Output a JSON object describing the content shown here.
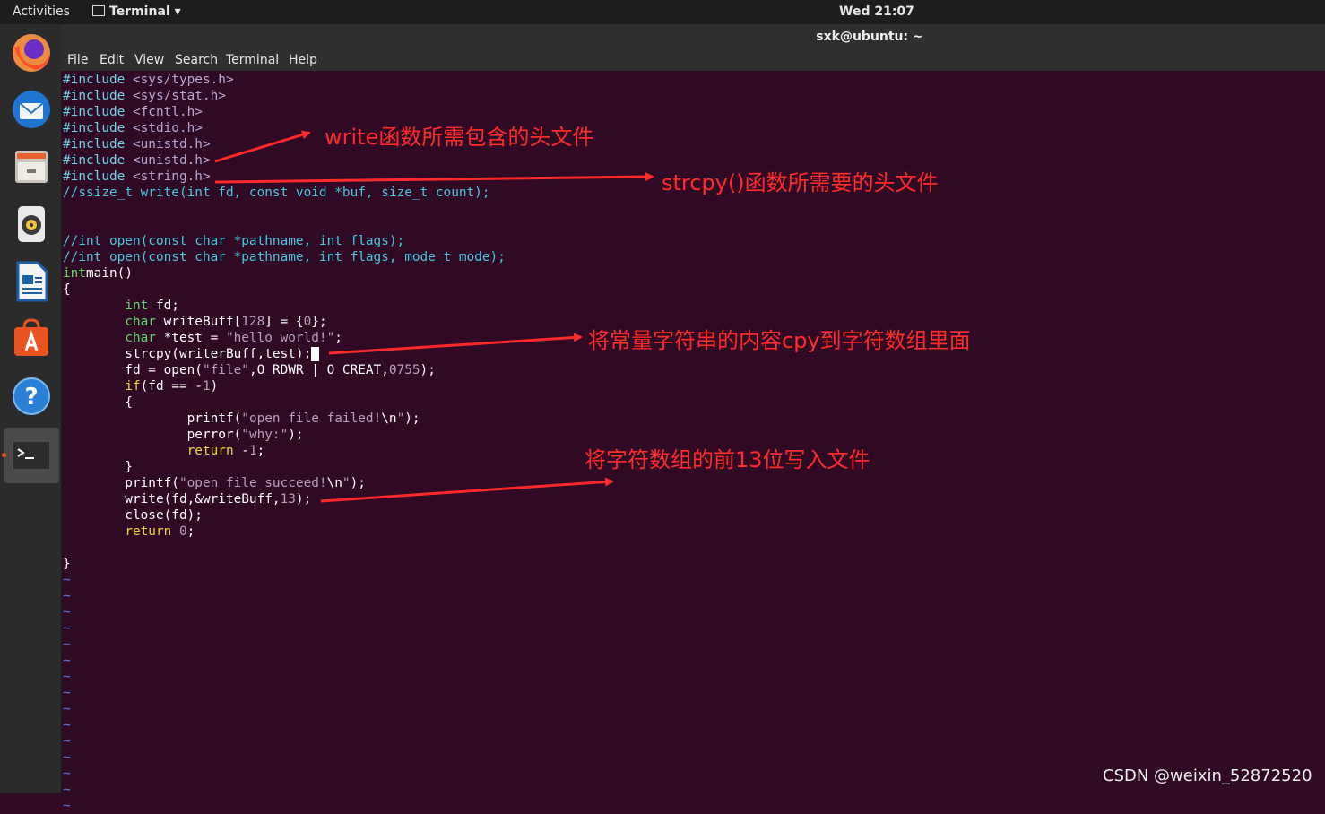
{
  "topbar": {
    "activities": "Activities",
    "app_name": "Terminal",
    "app_menu_arrow": "▾",
    "clock": "Wed 21:07"
  },
  "window": {
    "title": "sxk@ubuntu: ~"
  },
  "menu": [
    "File",
    "Edit",
    "View",
    "Search",
    "Terminal",
    "Help"
  ],
  "dock": [
    {
      "name": "firefox-icon"
    },
    {
      "name": "thunderbird-icon"
    },
    {
      "name": "files-icon"
    },
    {
      "name": "rhythmbox-icon"
    },
    {
      "name": "libreoffice-writer-icon"
    },
    {
      "name": "software-center-icon"
    },
    {
      "name": "help-icon"
    },
    {
      "name": "terminal-icon",
      "active": true
    }
  ],
  "code": [
    [
      [
        "pp",
        "#include "
      ],
      [
        "inc",
        "<sys/types.h>"
      ]
    ],
    [
      [
        "pp",
        "#include "
      ],
      [
        "inc",
        "<sys/stat.h>"
      ]
    ],
    [
      [
        "pp",
        "#include "
      ],
      [
        "inc",
        "<fcntl.h>"
      ]
    ],
    [
      [
        "pp",
        "#include "
      ],
      [
        "inc",
        "<stdio.h>"
      ]
    ],
    [
      [
        "pp",
        "#include "
      ],
      [
        "inc",
        "<unistd.h>"
      ]
    ],
    [
      [
        "pp",
        "#include "
      ],
      [
        "inc",
        "<unistd.h>"
      ]
    ],
    [
      [
        "pp",
        "#include "
      ],
      [
        "inc",
        "<string.h>"
      ]
    ],
    [
      [
        "cm",
        "//ssize_t write(int fd, const void *buf, size_t count);"
      ]
    ],
    [],
    [],
    [
      [
        "cm",
        "//int open(const char *pathname, int flags);"
      ]
    ],
    [
      [
        "cm",
        "//int open(const char *pathname, int flags, mode_t mode);"
      ]
    ],
    [
      [
        "ty",
        "int"
      ],
      [
        "",
        "main()"
      ]
    ],
    [
      [
        "",
        "{"
      ]
    ],
    [
      [
        "",
        "        "
      ],
      [
        "ty",
        "int"
      ],
      [
        "",
        " fd;"
      ]
    ],
    [
      [
        "",
        "        "
      ],
      [
        "ty",
        "char"
      ],
      [
        "",
        " writeBuff["
      ],
      [
        "nm",
        "128"
      ],
      [
        "",
        "] = {"
      ],
      [
        "nm",
        "0"
      ],
      [
        "",
        "};"
      ]
    ],
    [
      [
        "",
        "        "
      ],
      [
        "ty",
        "char"
      ],
      [
        "",
        " *test = "
      ],
      [
        "st",
        "\"hello world!\""
      ],
      [
        "",
        ";"
      ]
    ],
    [
      [
        "",
        "        strcpy(writerBuff,test);"
      ],
      [
        "cursor",
        " "
      ]
    ],
    [
      [
        "",
        "        fd = open("
      ],
      [
        "st",
        "\"file\""
      ],
      [
        "",
        ",O_RDWR | O_CREAT,"
      ],
      [
        "nm",
        "0755"
      ],
      [
        "",
        ");"
      ]
    ],
    [
      [
        "",
        "        "
      ],
      [
        "kw",
        "if"
      ],
      [
        "",
        "(fd == -"
      ],
      [
        "nm",
        "1"
      ],
      [
        "",
        ")"
      ]
    ],
    [
      [
        "",
        "        {"
      ]
    ],
    [
      [
        "",
        "                printf("
      ],
      [
        "st",
        "\"open file failed!"
      ],
      [
        "",
        "\\n"
      ],
      [
        "st",
        "\""
      ],
      [
        "",
        ");"
      ]
    ],
    [
      [
        "",
        "                perror("
      ],
      [
        "st",
        "\"why:\""
      ],
      [
        "",
        ");"
      ]
    ],
    [
      [
        "",
        "                "
      ],
      [
        "kw",
        "return"
      ],
      [
        "",
        " -"
      ],
      [
        "nm",
        "1"
      ],
      [
        "",
        ";"
      ]
    ],
    [
      [
        "",
        "        }"
      ]
    ],
    [
      [
        "",
        "        printf("
      ],
      [
        "st",
        "\"open file succeed!"
      ],
      [
        "",
        "\\n"
      ],
      [
        "st",
        "\""
      ],
      [
        "",
        ");"
      ]
    ],
    [
      [
        "",
        "        write(fd,&writeBuff,"
      ],
      [
        "nm",
        "13"
      ],
      [
        "",
        ");"
      ]
    ],
    [
      [
        "",
        "        close(fd);"
      ]
    ],
    [
      [
        "",
        "        "
      ],
      [
        "kw",
        "return"
      ],
      [
        "",
        " "
      ],
      [
        "nm",
        "0"
      ],
      [
        "",
        ";"
      ]
    ],
    [],
    [
      [
        "",
        "}"
      ]
    ]
  ],
  "tilde_char": "~",
  "tilde_count": 15,
  "annotations": [
    {
      "text": "write函数所需包含的头文件"
    },
    {
      "text": "strcpy()函数所需要的头文件"
    },
    {
      "text": "将常量字符串的内容cpy到字符数组里面"
    },
    {
      "text": "将字符数组的前13位写入文件"
    }
  ],
  "annotation_color": "#ff2a2a",
  "watermark": "CSDN @weixin_52872520"
}
